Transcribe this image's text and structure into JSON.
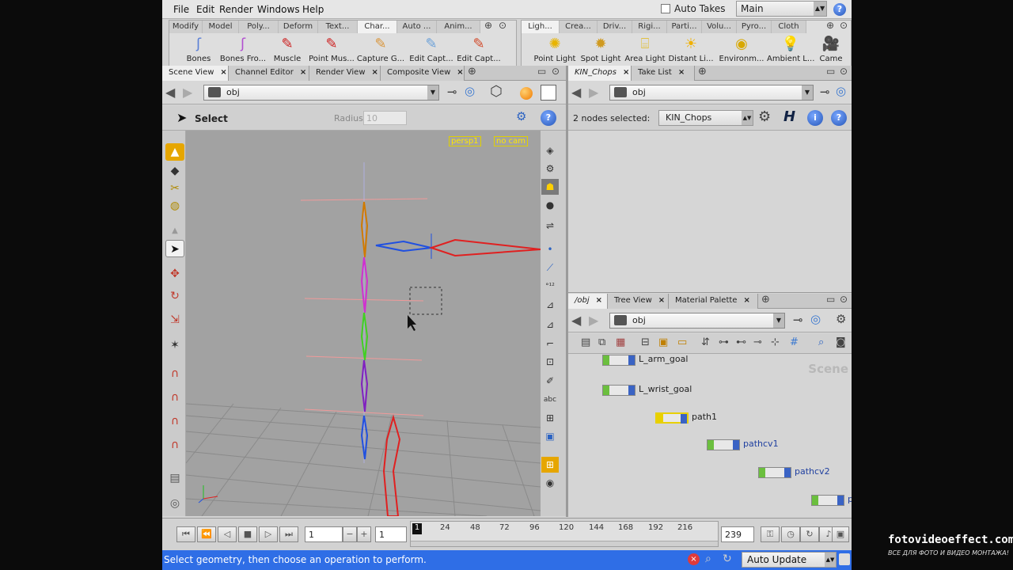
{
  "menu": [
    "File",
    "Edit",
    "Render",
    "Windows",
    "Help"
  ],
  "auto_takes": "Auto Takes",
  "take": "Main",
  "shelf_left": {
    "tabs": [
      "Modify",
      "Model",
      "Poly...",
      "Deform",
      "Text...",
      "Char...",
      "Auto ...",
      "Anim..."
    ],
    "tools": [
      "Bones",
      "Bones Fro...",
      "Muscle",
      "Point Mus...",
      "Capture G...",
      "Edit Capt...",
      "Edit Capt..."
    ]
  },
  "shelf_right": {
    "tabs": [
      "Ligh...",
      "Crea...",
      "Driv...",
      "Rigi...",
      "Parti...",
      "Volu...",
      "Pyro...",
      "Cloth"
    ],
    "tools": [
      "Point Light",
      "Spot Light",
      "Area Light",
      "Distant Li...",
      "Environm...",
      "Ambient L...",
      "Came"
    ]
  },
  "scene": {
    "tabs": [
      "Scene View",
      "Channel Editor",
      "Render View",
      "Composite View"
    ],
    "path": "obj",
    "tool": "Select",
    "radius_label": "Radius",
    "radius_value": "10",
    "persp": "persp1",
    "cam": "no cam"
  },
  "net_top": {
    "tabs": [
      "KIN_Chops",
      "Take List"
    ],
    "path": "obj",
    "selected": "2 nodes selected:",
    "node": "KIN_Chops"
  },
  "net_bottom": {
    "tabs": [
      "/obj",
      "Tree View",
      "Material Palette"
    ],
    "path": "obj",
    "scene_label": "Scene",
    "nodes": [
      "L_arm_goal",
      "L_wrist_goal",
      "path1",
      "pathcv1",
      "pathcv2",
      "pa"
    ]
  },
  "timeline": {
    "frame": "1",
    "start": "1",
    "end": "239",
    "ticks": [
      "24",
      "48",
      "72",
      "96",
      "120",
      "144",
      "168",
      "192",
      "216"
    ],
    "current": "1"
  },
  "status": "Select geometry, then choose an operation to perform.",
  "auto_update": "Auto Update",
  "watermark": {
    "site": "fotovideoeffect.com",
    "tagline": "ВСЕ ДЛЯ ФОТО И ВИДЕО МОНТАЖА!"
  }
}
